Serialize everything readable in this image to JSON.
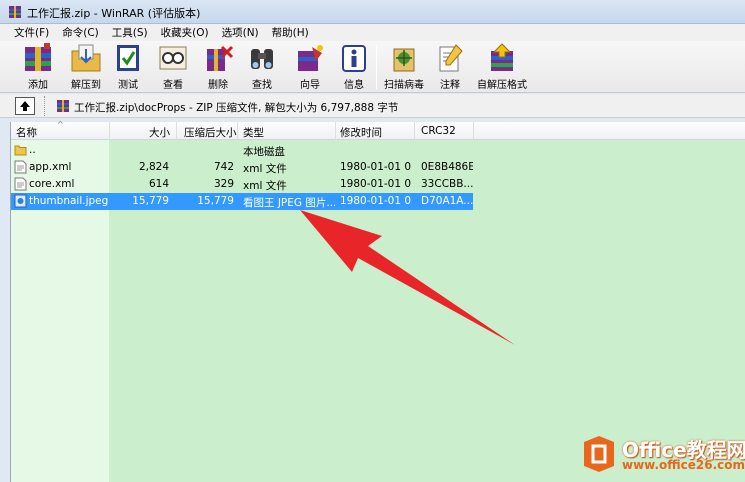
{
  "window": {
    "title": "工作汇报.zip - WinRAR (评估版本)"
  },
  "menu": [
    "文件(F)",
    "命令(C)",
    "工具(S)",
    "收藏夹(O)",
    "选项(N)",
    "帮助(H)"
  ],
  "toolbar": {
    "add": "添加",
    "extract_to": "解压到",
    "test": "测试",
    "view": "查看",
    "delete": "删除",
    "find": "查找",
    "wizard": "向导",
    "info": "信息",
    "virus_scan": "扫描病毒",
    "comment": "注释",
    "sfx": "自解压格式"
  },
  "path": {
    "text": "工作汇报.zip\\docProps - ZIP 压缩文件, 解包大小为 6,797,888 字节"
  },
  "columns": {
    "name": "名称",
    "size": "大小",
    "packed": "压缩后大小",
    "type": "类型",
    "modified": "修改时间",
    "crc": "CRC32"
  },
  "rows": [
    {
      "name": "..",
      "size": "",
      "packed": "",
      "type": "本地磁盘",
      "modified": "",
      "crc": ""
    },
    {
      "name": "app.xml",
      "size": "2,824",
      "packed": "742",
      "type": "xml 文件",
      "modified": "1980-01-01 0...",
      "crc": "0E8B486E"
    },
    {
      "name": "core.xml",
      "size": "614",
      "packed": "329",
      "type": "xml 文件",
      "modified": "1980-01-01 0...",
      "crc": "33CCBB..."
    },
    {
      "name": "thumbnail.jpeg",
      "size": "15,779",
      "packed": "15,779",
      "type": "看图王 JPEG 图片...",
      "modified": "1980-01-01 0...",
      "crc": "D70A1A..."
    }
  ],
  "watermark": {
    "title": "Office教程网",
    "url": "www.office26.com"
  },
  "colors": {
    "list_bg": "#cbefcd",
    "selection": "#3399ff",
    "arrow": "#e8262a",
    "watermark_orange": "#e8671d"
  }
}
